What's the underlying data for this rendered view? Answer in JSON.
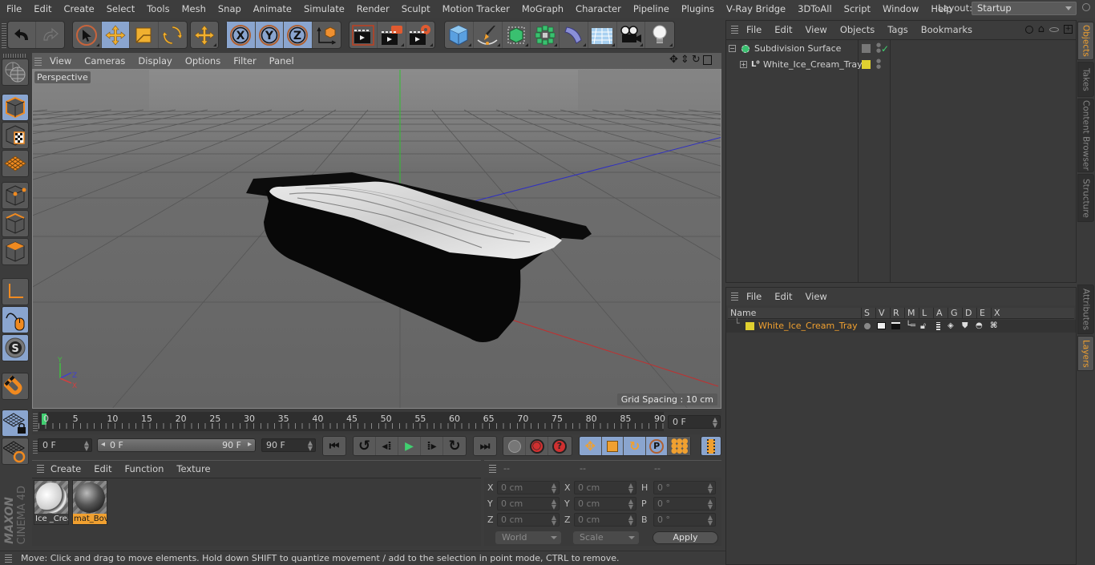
{
  "menu": [
    "File",
    "Edit",
    "Create",
    "Select",
    "Tools",
    "Mesh",
    "Snap",
    "Animate",
    "Simulate",
    "Render",
    "Sculpt",
    "Motion Tracker",
    "MoGraph",
    "Character",
    "Pipeline",
    "Plugins",
    "V-Ray Bridge",
    "3DToAll",
    "Script",
    "Window",
    "Help"
  ],
  "layout": {
    "label": "Layout:",
    "value": "Startup"
  },
  "toolbar": {
    "icons": [
      "undo-icon",
      "redo-icon",
      "live-selection-icon",
      "move-icon",
      "scale-icon",
      "rotate-icon",
      "recent-tool-icon",
      "lock-x-icon",
      "lock-y-icon",
      "lock-z-icon",
      "coordinate-system-icon",
      "render-view-icon",
      "render-to-picture-viewer-icon",
      "render-settings-icon",
      "cube-icon",
      "pen-icon",
      "subdivision-icon",
      "cloner-icon",
      "deformer-icon",
      "floor-icon",
      "camera-icon",
      "light-icon"
    ],
    "axis_labels": [
      "X",
      "Y",
      "Z"
    ]
  },
  "viewport": {
    "menu": [
      "View",
      "Cameras",
      "Display",
      "Options",
      "Filter",
      "Panel"
    ],
    "camera": "Perspective",
    "grid_spacing": "Grid Spacing : 10 cm",
    "axis": {
      "x": "X",
      "y": "Y",
      "z": "Z"
    },
    "colors": {
      "x": "#d04040",
      "y": "#40c040",
      "z": "#4040d0"
    }
  },
  "timeline": {
    "ticks": [
      "0",
      "5",
      "10",
      "15",
      "20",
      "25",
      "30",
      "35",
      "40",
      "45",
      "50",
      "55",
      "60",
      "65",
      "70",
      "75",
      "80",
      "85",
      "90"
    ],
    "current_frame": "0 F",
    "start": "0 F",
    "range_start": "0 F",
    "range_end": "90 F",
    "end": "90 F"
  },
  "materials": {
    "menu": [
      "Create",
      "Edit",
      "Function",
      "Texture"
    ],
    "items": [
      {
        "name": "Ice _Crea",
        "selected": false
      },
      {
        "name": "mat_Bov",
        "selected": true
      }
    ]
  },
  "coords": {
    "headers": [
      "--",
      "--",
      "--"
    ],
    "rows": [
      {
        "a": "X",
        "av": "0 cm",
        "b": "X",
        "bv": "0 cm",
        "c": "H",
        "cv": "0 °"
      },
      {
        "a": "Y",
        "av": "0 cm",
        "b": "Y",
        "bv": "0 cm",
        "c": "P",
        "cv": "0 °"
      },
      {
        "a": "Z",
        "av": "0 cm",
        "b": "Z",
        "bv": "0 cm",
        "c": "B",
        "cv": "0 °"
      }
    ],
    "space": "World",
    "mode": "Scale",
    "apply": "Apply"
  },
  "status": "Move: Click and drag to move elements. Hold down SHIFT to quantize movement / add to the selection in point mode, CTRL to remove.",
  "objects": {
    "menu": [
      "File",
      "Edit",
      "View",
      "Objects",
      "Tags",
      "Bookmarks"
    ],
    "items": [
      {
        "name": "Subdivision Surface",
        "expanded": true
      },
      {
        "name": "White_Ice_Cream_Tray",
        "expanded": false
      }
    ]
  },
  "layers": {
    "menu": [
      "File",
      "Edit",
      "View"
    ],
    "columns": [
      "Name",
      "S",
      "V",
      "R",
      "M",
      "L",
      "A",
      "G",
      "D",
      "E",
      "X"
    ],
    "items": [
      {
        "name": "White_Ice_Cream_Tray",
        "color": "#e0d030"
      }
    ]
  },
  "side_tabs": [
    "Objects",
    "Takes",
    "Content Browser",
    "Structure"
  ],
  "side_tabs_bottom": [
    "Attributes",
    "Layers"
  ],
  "brand": {
    "maker": "MAXON",
    "product": "CINEMA 4D"
  }
}
